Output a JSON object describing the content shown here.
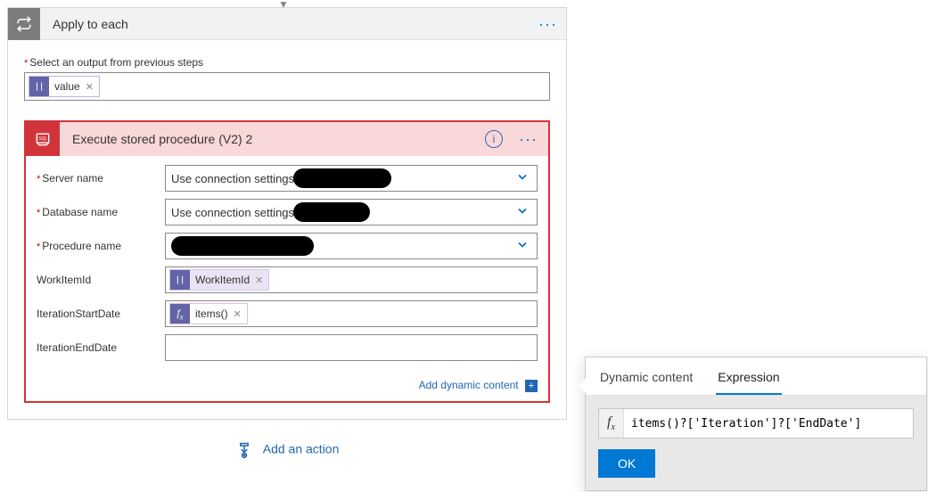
{
  "outer": {
    "title": "Apply to each",
    "selectLabel": "Select an output from previous steps",
    "valueToken": "value"
  },
  "inner": {
    "title": "Execute stored procedure (V2) 2",
    "fields": {
      "serverLabel": "Server name",
      "serverValue": "Use connection settings",
      "dbLabel": "Database name",
      "dbValue": "Use connection settings",
      "procLabel": "Procedure name",
      "workItemLabel": "WorkItemId",
      "workItemToken": "WorkItemId",
      "iterStartLabel": "IterationStartDate",
      "iterStartToken": "items()",
      "iterEndLabel": "IterationEndDate"
    },
    "addDynamic": "Add dynamic content"
  },
  "addAction": "Add an action",
  "popup": {
    "tabDynamic": "Dynamic content",
    "tabExpression": "Expression",
    "expression": "items()?['Iteration']?['EndDate']",
    "ok": "OK"
  }
}
